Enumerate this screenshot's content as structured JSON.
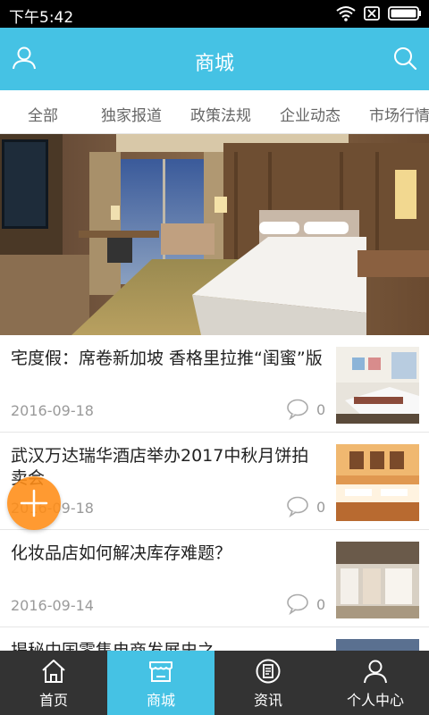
{
  "status_bar": {
    "time": "下午5:42"
  },
  "header": {
    "title": "商城"
  },
  "tabs": [
    "全部",
    "独家报道",
    "政策法规",
    "企业动态",
    "市场行情"
  ],
  "news": [
    {
      "title": "宅度假：席卷新加坡 香格里拉推“闺蜜”版",
      "date": "2016-09-18",
      "comments": "0"
    },
    {
      "title": "武汉万达瑞华酒店举办2017中秋月饼拍卖会",
      "date": "2016-09-18",
      "comments": "0"
    },
    {
      "title": "化妆品店如何解决库存难题？",
      "date": "2016-09-14",
      "comments": "0"
    },
    {
      "title": "揭秘中国零售电商发展史之",
      "date": "",
      "comments": ""
    }
  ],
  "bottom_nav": [
    {
      "label": "首页",
      "icon": "home-icon"
    },
    {
      "label": "商城",
      "icon": "store-icon"
    },
    {
      "label": "资讯",
      "icon": "news-icon"
    },
    {
      "label": "个人中心",
      "icon": "user-icon"
    }
  ],
  "colors": {
    "accent": "#45c2e4",
    "nav_bg": "#333333",
    "fab": "#ff8c14"
  }
}
